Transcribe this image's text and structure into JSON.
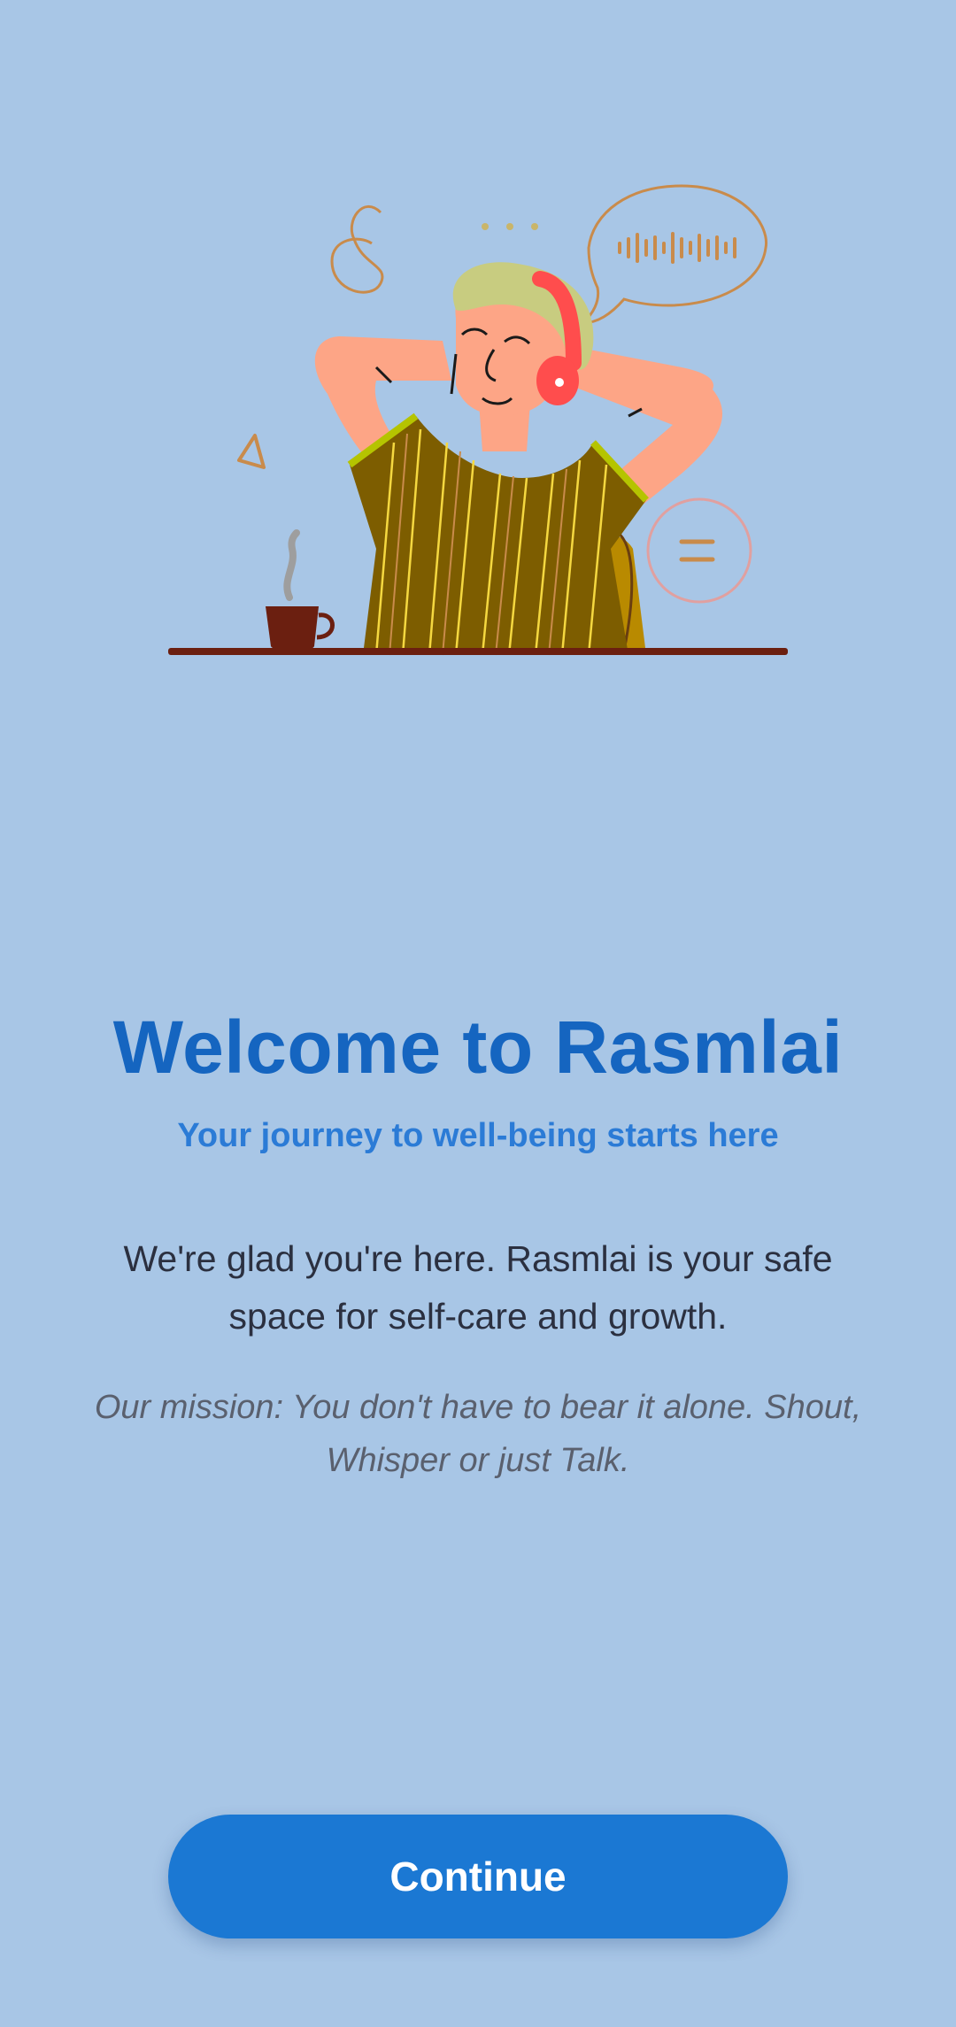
{
  "welcome": {
    "title": "Welcome to Rasmlai",
    "subtitle": "Your journey to well-being starts here",
    "intro": "We're glad you're here. Rasmlai is your safe space for self-care and growth.",
    "mission": "Our mission: You don't have to bear it alone. Shout, Whisper or just Talk."
  },
  "actions": {
    "continue_label": "Continue"
  },
  "illustration": {
    "name": "relaxing-person-with-headphones-illustration"
  },
  "colors": {
    "background": "#a8c6e6",
    "title": "#1565c0",
    "subtitle": "#2b7bd6",
    "button": "#1b78d3"
  }
}
